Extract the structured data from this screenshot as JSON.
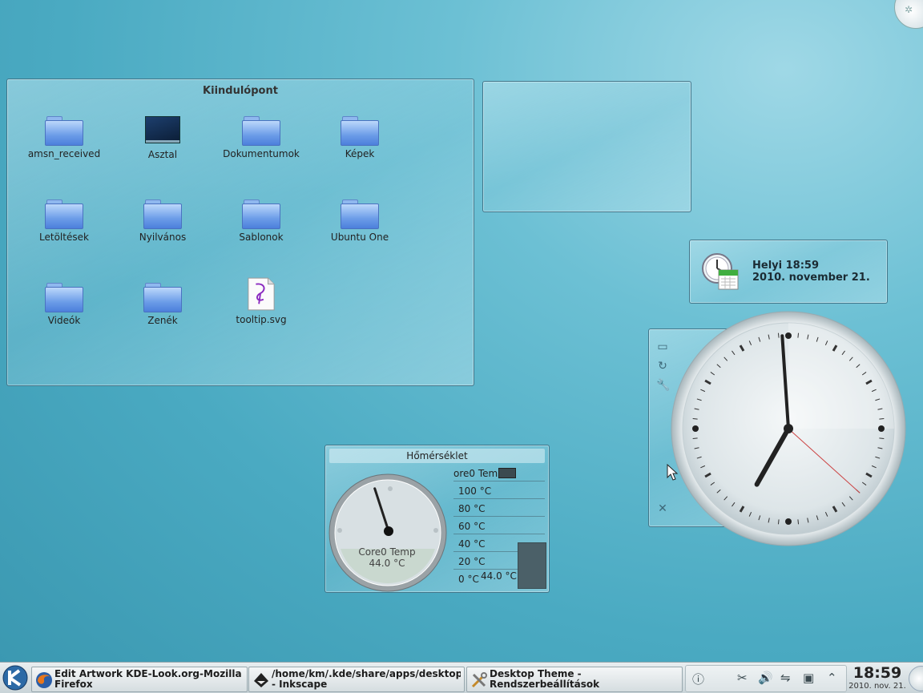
{
  "folderview": {
    "title": "Kiindulópont",
    "items": [
      "amsn_received",
      "Asztal",
      "Dokumentumok",
      "Képek",
      "Letöltések",
      "Nyilvános",
      "Sablonok",
      "Ubuntu One",
      "Videók",
      "Zenék",
      "tooltip.svg"
    ]
  },
  "datewidget": {
    "time": "Helyi 18:59",
    "date": "2010. november 21."
  },
  "temperature": {
    "title": "Hőmérséklet",
    "gauge_label": "Core0 Temp",
    "gauge_value": "44.0 °C",
    "legend": "ore0 Tem",
    "scale": [
      "100 °C",
      "80 °C",
      "60 °C",
      "40 °C",
      "20 °C",
      "0 °C"
    ],
    "current": "44.0 °C",
    "needle_value": 44
  },
  "analog_clock": {
    "hours": 18,
    "minutes": 59,
    "seconds": 22
  },
  "taskbar": {
    "tasks": [
      {
        "line1": "Edit Artwork KDE-Look.org-Mozilla",
        "line2": "Firefox",
        "icon": "firefox-icon"
      },
      {
        "line1": "/home/km/.kde/share/apps/desktopthe",
        "line2": "- Inkscape",
        "icon": "inkscape-icon"
      },
      {
        "line1": "Desktop Theme -",
        "line2": "Rendszerbeállítások",
        "icon": "settings-tools-icon"
      }
    ],
    "clock_time": "18:59",
    "clock_date": "2010. nov. 21."
  }
}
